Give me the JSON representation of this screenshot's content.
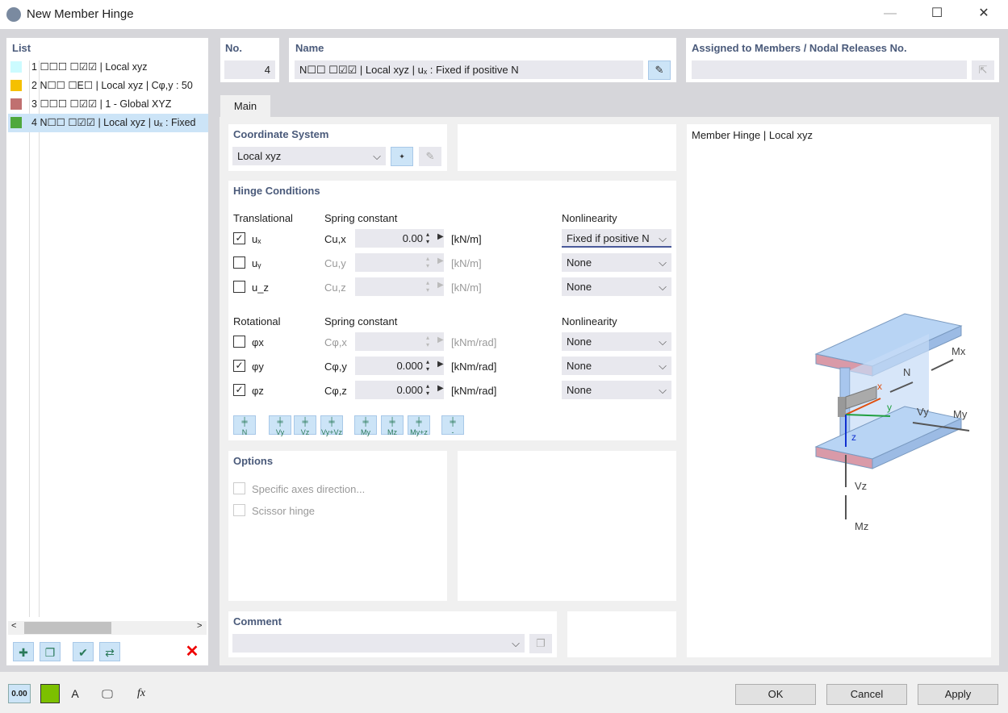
{
  "window": {
    "title": "New Member Hinge",
    "minimize": "—",
    "maximize": "☐",
    "close": "✕"
  },
  "list": {
    "header": "List",
    "items": [
      {
        "no": "1",
        "code": "☐☐☐ ☐☑☑",
        "text": "| Local xyz",
        "color": "#ccfbff"
      },
      {
        "no": "2",
        "code": "N☐☐ ☐E☐",
        "text": "| Local xyz | Cφ,y : 50",
        "color": "#f5c000"
      },
      {
        "no": "3",
        "code": "☐☐☐ ☐☑☑",
        "text": "| 1 - Global XYZ",
        "color": "#c07070"
      },
      {
        "no": "4",
        "code": "N☐☐ ☐☑☑",
        "text": "| Local xyz | uₓ : Fixed",
        "color": "#4ea83c"
      }
    ]
  },
  "no": {
    "label": "No.",
    "value": "4"
  },
  "name": {
    "label": "Name",
    "value": "N☐☐ ☐☑☑ | Local xyz | uₓ : Fixed if positive N"
  },
  "assigned": {
    "label": "Assigned to Members / Nodal Releases No.",
    "value": ""
  },
  "tabs": [
    "Main"
  ],
  "coord": {
    "label": "Coordinate System",
    "value": "Local xyz"
  },
  "hinge": {
    "label": "Hinge Conditions",
    "trans_label": "Translational",
    "spring_label": "Spring constant",
    "nonlin_label": "Nonlinearity",
    "rot_label": "Rotational",
    "rows": [
      {
        "checked": true,
        "name": "uₓ",
        "sym": "Cu,x",
        "value": "0.00",
        "unit": "[kN/m]",
        "nonlin": "Fixed if positive N"
      },
      {
        "checked": false,
        "name": "uᵧ",
        "sym": "Cu,y",
        "value": "",
        "unit": "[kN/m]",
        "nonlin": "None"
      },
      {
        "checked": false,
        "name": "u_z",
        "sym": "Cu,z",
        "value": "",
        "unit": "[kN/m]",
        "nonlin": "None"
      },
      {
        "checked": false,
        "name": "φx",
        "sym": "Cφ,x",
        "value": "",
        "unit": "[kNm/rad]",
        "nonlin": "None"
      },
      {
        "checked": true,
        "name": "φy",
        "sym": "Cφ,y",
        "value": "0.000",
        "unit": "[kNm/rad]",
        "nonlin": "None"
      },
      {
        "checked": true,
        "name": "φz",
        "sym": "Cφ,z",
        "value": "0.000",
        "unit": "[kNm/rad]",
        "nonlin": "None"
      }
    ],
    "presets": [
      "N",
      "Vy",
      "Vz",
      "Vy+Vz",
      "My",
      "Mz",
      "My+z",
      "-"
    ]
  },
  "options": {
    "label": "Options",
    "items": [
      "Specific axes direction...",
      "Scissor hinge"
    ]
  },
  "comment": {
    "label": "Comment",
    "value": ""
  },
  "preview": {
    "title": "Member Hinge | Local xyz",
    "labels": {
      "Mx": "Mx",
      "N": "N",
      "x": "x",
      "y": "y",
      "Vy": "Vy",
      "My": "My",
      "z": "z",
      "Vz": "Vz",
      "Mz": "Mz"
    }
  },
  "footer": {
    "ok": "OK",
    "cancel": "Cancel",
    "apply": "Apply",
    "units": "0.00"
  }
}
